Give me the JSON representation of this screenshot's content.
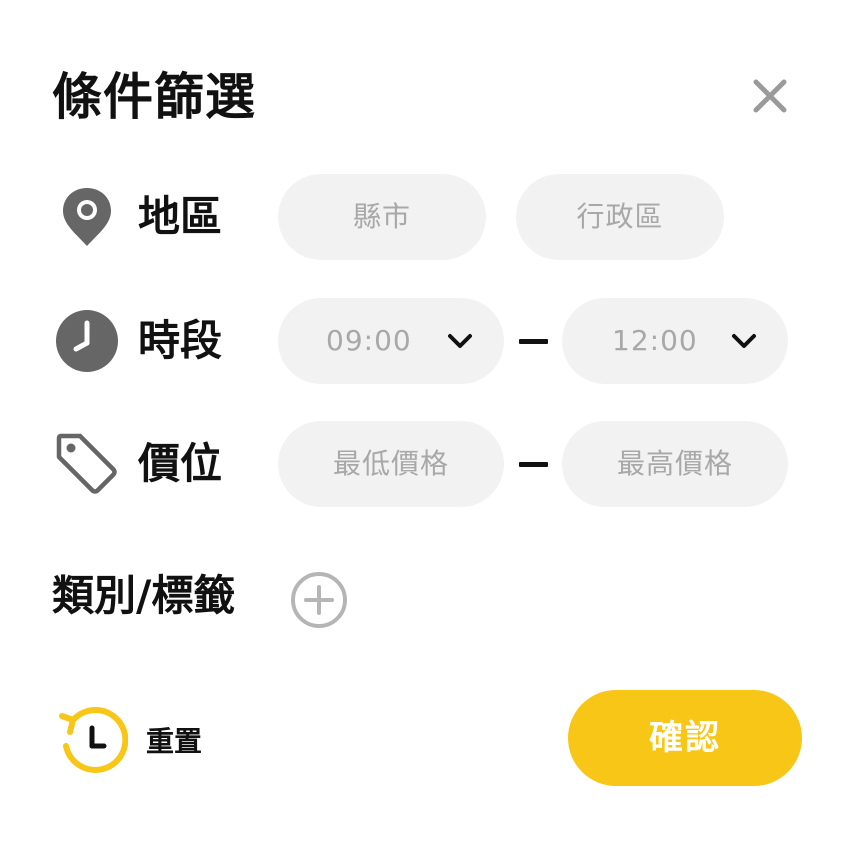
{
  "header": {
    "title": "條件篩選",
    "close_icon": "close-icon"
  },
  "region": {
    "label": "地區",
    "icon": "location-pin-icon",
    "city_placeholder": "縣市",
    "district_placeholder": "行政區"
  },
  "time": {
    "label": "時段",
    "icon": "clock-icon",
    "start": "09:00",
    "end": "12:00"
  },
  "price": {
    "label": "價位",
    "icon": "price-tag-icon",
    "min_placeholder": "最低價格",
    "max_placeholder": "最高價格"
  },
  "category": {
    "label": "類別/標籤",
    "add_icon": "plus-circle-icon"
  },
  "footer": {
    "reset_label": "重置",
    "reset_icon": "reset-clock-icon",
    "confirm_label": "確認"
  },
  "colors": {
    "accent": "#f8c617",
    "field_bg": "#f2f2f2",
    "placeholder_text": "#a8a8a8",
    "icon_gray": "#666666",
    "text": "#111111"
  }
}
